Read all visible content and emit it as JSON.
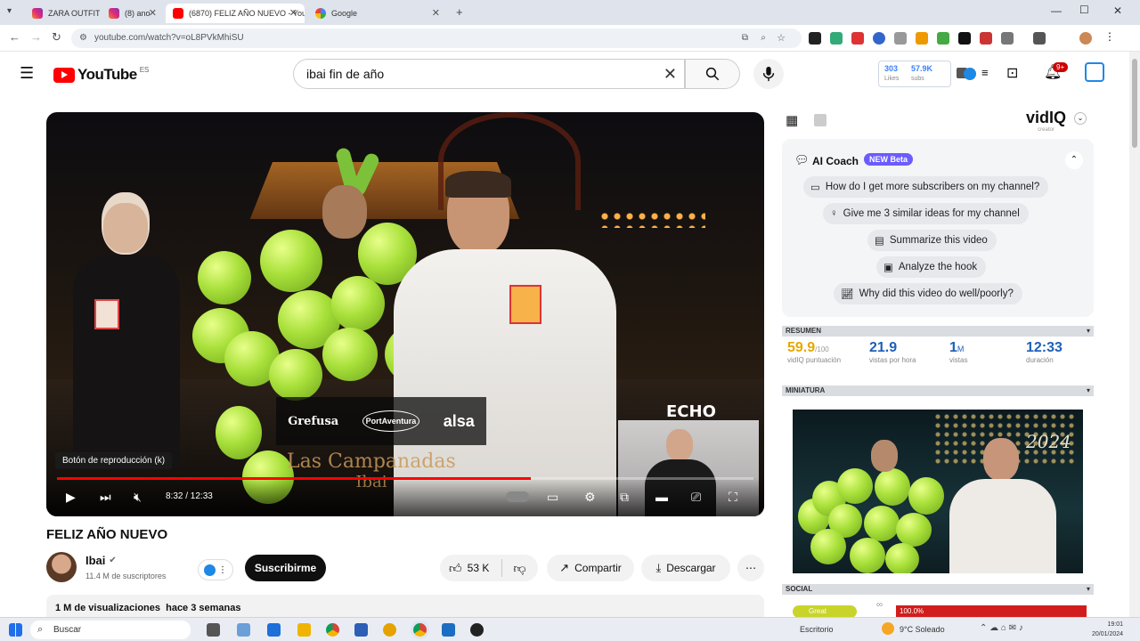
{
  "browser": {
    "tabs": [
      {
        "label": "ZARA OUTFITS",
        "active": false
      },
      {
        "label": "(8) ano",
        "active": false
      },
      {
        "label": "(6870) FELIZ AÑO NUEVO - You",
        "active": true
      },
      {
        "label": "Google",
        "active": false
      }
    ],
    "new_tab_symbol": "+",
    "url": "youtube.com/watch?v=oL8PVkMhiSU"
  },
  "youtube": {
    "logo_text": "YouTube",
    "logo_suffix": "ES",
    "search_value": "ibai fin de año",
    "ext_stats": {
      "a_value": "303",
      "a_label": "Likes",
      "b_value": "57.9K",
      "b_label": "subs"
    },
    "notif_count": "9+"
  },
  "video": {
    "caption_tooltip": "Botón de reproducción (k)",
    "time": "8:32 / 12:33",
    "progress": 0.68,
    "sponsors": [
      "Grefusa",
      "PortAventura",
      "alsa"
    ],
    "echo": "ECHO",
    "overlay_title": "Las Campanadas",
    "overlay_sub": "Ibai"
  },
  "below": {
    "title": "FELIZ AÑO NUEVO",
    "channel": "Ibai",
    "subscribers": "11.4 M de suscriptores",
    "subscribe": "Suscribirme",
    "likes": "53 K",
    "share": "Compartir",
    "download": "Descargar",
    "description_meta": "1 M de visualizaciones  hace 3 semanas"
  },
  "vidiq": {
    "logo": "vidIQ",
    "logo_sub": "creator",
    "coach_title": "AI Coach",
    "coach_badge": "NEW Beta",
    "prompts": [
      "How do I get more subscribers on my channel?",
      "Give me 3 similar ideas for my channel",
      "Summarize this video",
      "Analyze the hook",
      "Why did this video do well/poorly?"
    ],
    "section_summary": "RESUMEN",
    "stats": [
      {
        "value": "59.9",
        "suffix": "/100",
        "label": "vidIQ puntuación"
      },
      {
        "value": "21.9",
        "suffix": "",
        "label": "vistas por hora"
      },
      {
        "value": "1",
        "suffix": "M",
        "label": "vistas"
      },
      {
        "value": "12:33",
        "suffix": "",
        "label": "duración"
      }
    ],
    "section_thumbnail": "MINIATURA",
    "thumb_year": "2024",
    "section_social": "SOCIAL",
    "social_green": "Great",
    "social_red": "100.0%"
  },
  "taskbar": {
    "search": "Buscar",
    "desktop": "Escritorio",
    "weather": "9°C Soleado",
    "time": "19:01",
    "date": "20/01/2024"
  },
  "colors": {
    "youtube_red": "#ff0000",
    "vidiq_accent": "#3b82f6",
    "badge_purple": "#6b5cff"
  }
}
